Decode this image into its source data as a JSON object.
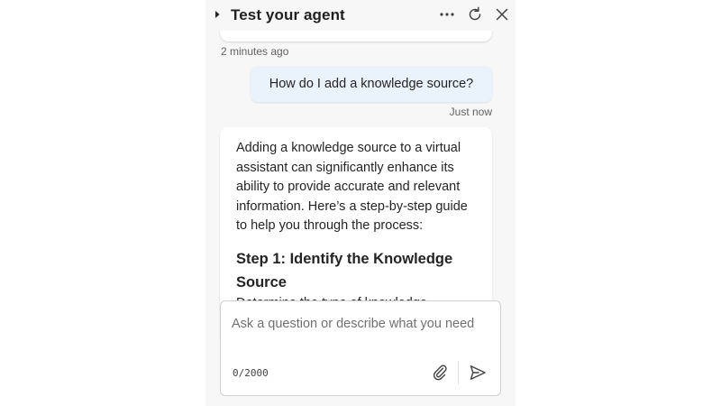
{
  "header": {
    "title": "Test your agent",
    "icons": {
      "collapse": "caret-right-icon",
      "more": "more-horizontal-icon",
      "refresh": "refresh-icon",
      "close": "close-icon"
    }
  },
  "conversation": {
    "previous_timestamp": "2 minutes ago",
    "user_message": "How do I add a knowledge source?",
    "user_timestamp": "Just now",
    "bot_message": {
      "intro": "Adding a knowledge source to a virtual assistant can significantly enhance its ability to provide accurate and relevant information. Here’s a step-by-step guide to help you through the process:",
      "step_heading": "Step 1: Identify the Knowledge Source",
      "partial_line": "Determine the type of knowledge"
    }
  },
  "composer": {
    "placeholder": "Ask a question or describe what you need",
    "value": "",
    "counter": "0/2000",
    "icons": {
      "attach": "paperclip-icon",
      "send": "send-icon"
    }
  },
  "colors": {
    "panel_bg": "#f7f7f7",
    "user_bubble_bg": "#eaf3fb",
    "bot_bubble_bg": "#ffffff",
    "text": "#242424",
    "muted": "#616161"
  }
}
